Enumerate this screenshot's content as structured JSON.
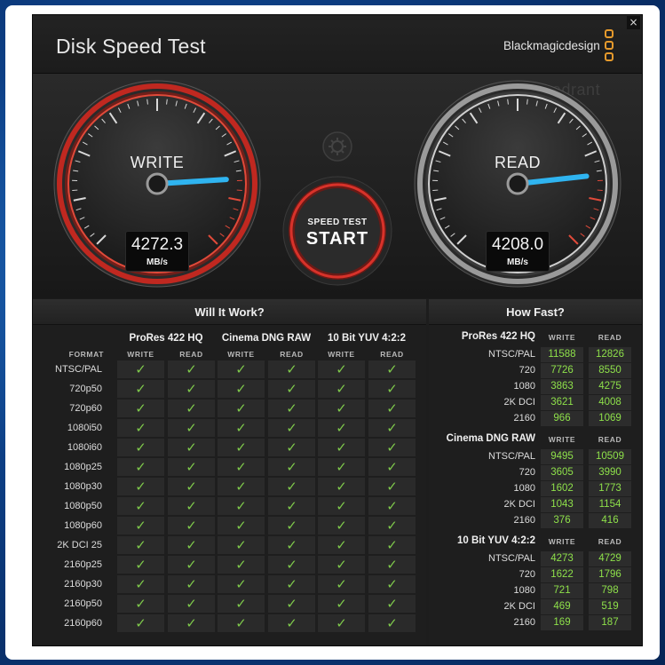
{
  "app": {
    "title": "Disk Speed Test",
    "brand": "Blackmagicdesign",
    "watermark": "4th Quadrant",
    "close_glyph": "×"
  },
  "gauges": {
    "write": {
      "label": "WRITE",
      "value": "4272.3",
      "unit": "MB/s",
      "needle_fraction": 0.82
    },
    "read": {
      "label": "READ",
      "value": "4208.0",
      "unit": "MB/s",
      "needle_fraction": 0.81
    }
  },
  "start_button": {
    "line1": "SPEED TEST",
    "line2": "START"
  },
  "settings_icon": "gear-icon",
  "colors": {
    "accent_red": "#d8322a",
    "accent_blue": "#2fb4f0",
    "check_green": "#7ec84b",
    "value_green": "#8ee04a",
    "brand_orange": "#e69a2c"
  },
  "will_it_work": {
    "title": "Will It Work?",
    "format_label": "FORMAT",
    "groups": [
      {
        "name": "ProRes 422 HQ",
        "cols": [
          "WRITE",
          "READ"
        ]
      },
      {
        "name": "Cinema DNG RAW",
        "cols": [
          "WRITE",
          "READ"
        ]
      },
      {
        "name": "10 Bit YUV 4:2:2",
        "cols": [
          "WRITE",
          "READ"
        ]
      }
    ],
    "rows": [
      "NTSC/PAL",
      "720p50",
      "720p60",
      "1080i50",
      "1080i60",
      "1080p25",
      "1080p30",
      "1080p50",
      "1080p60",
      "2K DCI 25",
      "2160p25",
      "2160p30",
      "2160p50",
      "2160p60"
    ],
    "check": "✓"
  },
  "how_fast": {
    "title": "How Fast?",
    "col_write": "WRITE",
    "col_read": "READ",
    "groups": [
      {
        "name": "ProRes 422 HQ",
        "rows": [
          {
            "label": "NTSC/PAL",
            "write": "11588",
            "read": "12826"
          },
          {
            "label": "720",
            "write": "7726",
            "read": "8550"
          },
          {
            "label": "1080",
            "write": "3863",
            "read": "4275"
          },
          {
            "label": "2K DCI",
            "write": "3621",
            "read": "4008"
          },
          {
            "label": "2160",
            "write": "966",
            "read": "1069"
          }
        ]
      },
      {
        "name": "Cinema DNG RAW",
        "rows": [
          {
            "label": "NTSC/PAL",
            "write": "9495",
            "read": "10509"
          },
          {
            "label": "720",
            "write": "3605",
            "read": "3990"
          },
          {
            "label": "1080",
            "write": "1602",
            "read": "1773"
          },
          {
            "label": "2K DCI",
            "write": "1043",
            "read": "1154"
          },
          {
            "label": "2160",
            "write": "376",
            "read": "416"
          }
        ]
      },
      {
        "name": "10 Bit YUV 4:2:2",
        "rows": [
          {
            "label": "NTSC/PAL",
            "write": "4273",
            "read": "4729"
          },
          {
            "label": "720",
            "write": "1622",
            "read": "1796"
          },
          {
            "label": "1080",
            "write": "721",
            "read": "798"
          },
          {
            "label": "2K DCI",
            "write": "469",
            "read": "519"
          },
          {
            "label": "2160",
            "write": "169",
            "read": "187"
          }
        ]
      }
    ]
  }
}
